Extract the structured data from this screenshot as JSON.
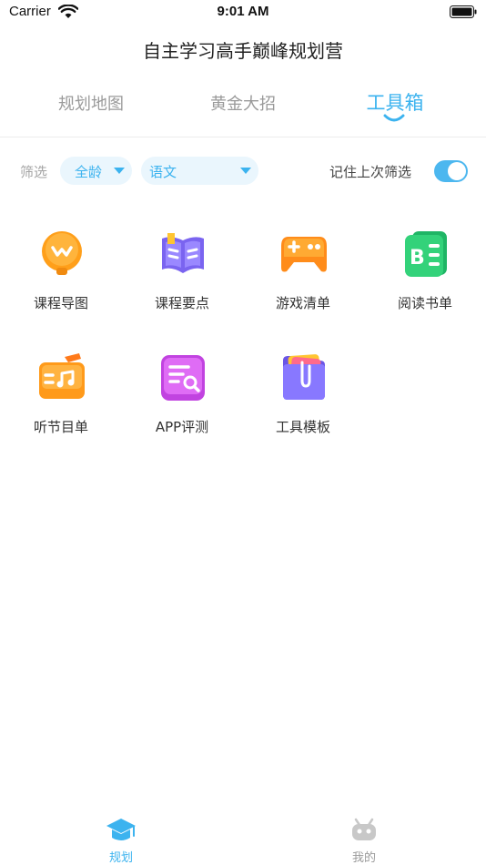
{
  "status_bar": {
    "carrier": "Carrier",
    "time": "9:01 AM"
  },
  "header": {
    "title": "自主学习高手巅峰规划营"
  },
  "tabs": [
    {
      "label": "规划地图",
      "active": false
    },
    {
      "label": "黄金大招",
      "active": false
    },
    {
      "label": "工具箱",
      "active": true
    }
  ],
  "filter": {
    "label": "筛选",
    "age": "全龄",
    "subject": "语文",
    "remember_label": "记住上次筛选",
    "remember_on": true
  },
  "tools": [
    {
      "label": "课程导图",
      "icon": "lightbulb-icon",
      "color": "#ff9f1a"
    },
    {
      "label": "课程要点",
      "icon": "book-icon",
      "color": "#7a64f0"
    },
    {
      "label": "游戏清单",
      "icon": "gamepad-icon",
      "color": "#ff8c1a"
    },
    {
      "label": "阅读书单",
      "icon": "reading-list-icon",
      "color": "#22c46c"
    },
    {
      "label": "听节目单",
      "icon": "radio-icon",
      "color": "#ff9a1a"
    },
    {
      "label": "APP评测",
      "icon": "app-review-icon",
      "color": "#d04de8"
    },
    {
      "label": "工具模板",
      "icon": "folder-template-icon",
      "color": "#7b6af0"
    }
  ],
  "bottom_nav": [
    {
      "label": "规划",
      "icon": "graduation-cap-icon",
      "active": true
    },
    {
      "label": "我的",
      "icon": "robot-icon",
      "active": false
    }
  ],
  "colors": {
    "accent": "#3cb3ef",
    "inactive": "#9a9a9a"
  }
}
